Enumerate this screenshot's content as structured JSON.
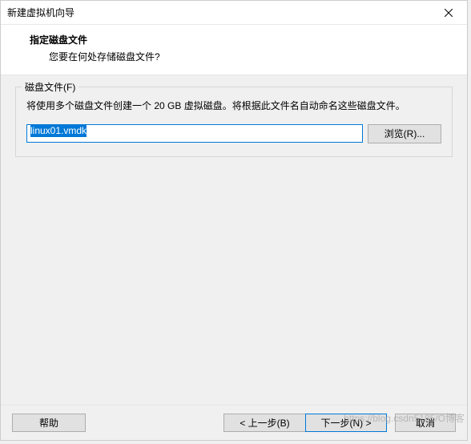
{
  "window": {
    "title": "新建虚拟机向导"
  },
  "header": {
    "title": "指定磁盘文件",
    "subtitle": "您要在何处存储磁盘文件?"
  },
  "group": {
    "label": "磁盘文件(F)",
    "description": "将使用多个磁盘文件创建一个 20 GB 虚拟磁盘。将根据此文件名自动命名这些磁盘文件。",
    "file_value": "linux01.vmdk",
    "browse_label": "浏览(R)..."
  },
  "footer": {
    "help": "帮助",
    "back": "< 上一步(B)",
    "next": "下一步(N) >",
    "cancel": "取消"
  },
  "watermark": "https://blog.csdn5185/O博客"
}
